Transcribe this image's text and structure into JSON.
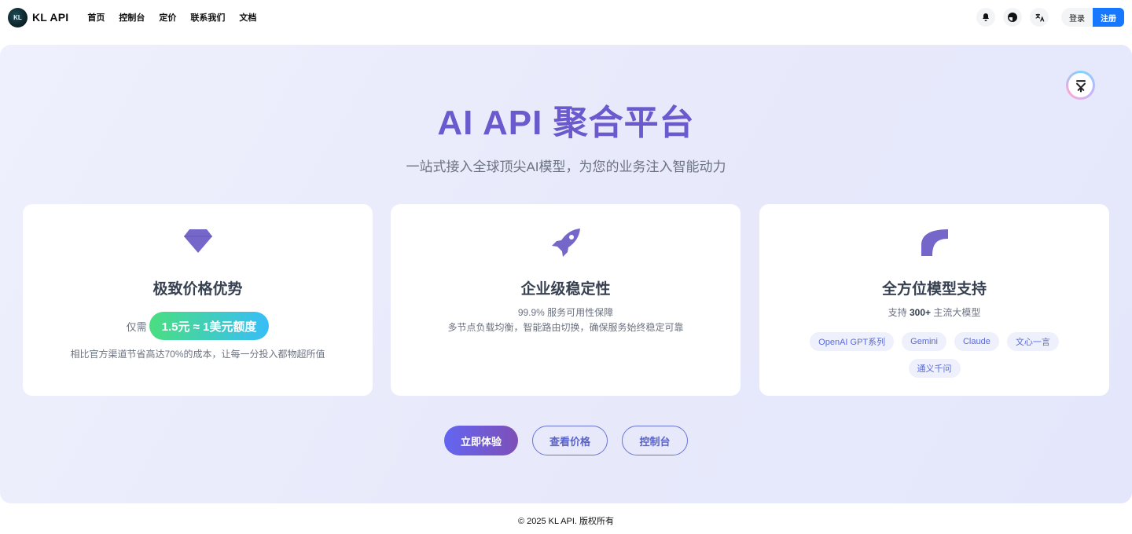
{
  "brand": {
    "name": "KL API",
    "logo_text": "KL"
  },
  "nav": [
    "首页",
    "控制台",
    "定价",
    "联系我们",
    "文档"
  ],
  "header_icons": [
    "bell-icon",
    "theme-icon",
    "translate-icon"
  ],
  "auth": {
    "login": "登录",
    "register": "注册"
  },
  "hero": {
    "title": "AI API 聚合平台",
    "subtitle": "一站式接入全球顶尖AI模型，为您的业务注入智能动力"
  },
  "cards": {
    "price": {
      "title": "极致价格优势",
      "prefix": "仅需",
      "pill": "1.5元 ≈ 1美元额度",
      "desc": "相比官方渠道节省高达70%的成本，让每一分投入都物超所值"
    },
    "stable": {
      "title": "企业级稳定性",
      "line1": "99.9% 服务可用性保障",
      "line2": "多节点负载均衡，智能路由切换，确保服务始终稳定可靠"
    },
    "models": {
      "title": "全方位模型支持",
      "desc_pre": "支持 ",
      "desc_bold": "300+",
      "desc_post": " 主流大模型",
      "tags": [
        "OpenAI GPT系列",
        "Gemini",
        "Claude",
        "文心一言",
        "通义千问"
      ]
    }
  },
  "actions": {
    "try": "立即体验",
    "pricing": "查看价格",
    "console": "控制台"
  },
  "footer": "© 2025 KL API. 版权所有",
  "colors": {
    "accent": "#6a5acd",
    "primary": "#1677ff",
    "icon": "#7566c9"
  }
}
